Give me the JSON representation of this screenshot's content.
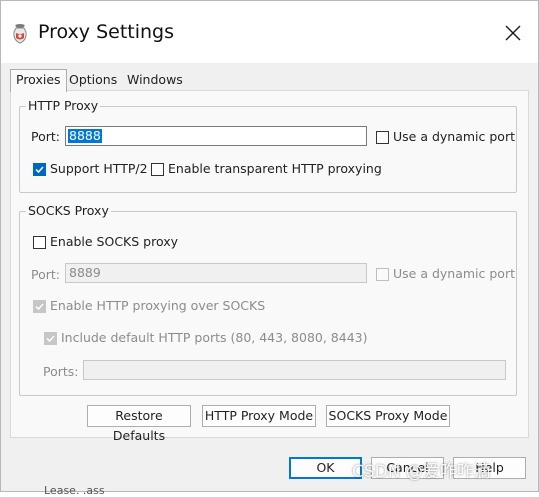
{
  "window": {
    "title": "Proxy Settings"
  },
  "tabs": [
    {
      "label": "Proxies",
      "active": true
    },
    {
      "label": "Options",
      "active": false
    },
    {
      "label": "Windows",
      "active": false
    }
  ],
  "http_proxy": {
    "legend": "HTTP Proxy",
    "port_label": "Port:",
    "port_value": "8888",
    "dynamic_port": {
      "label": "Use a dynamic port",
      "checked": false
    },
    "support_http2": {
      "label": "Support HTTP/2",
      "checked": true
    },
    "transparent": {
      "label": "Enable transparent HTTP proxying",
      "checked": false
    }
  },
  "socks_proxy": {
    "legend": "SOCKS Proxy",
    "enable": {
      "label": "Enable SOCKS proxy",
      "checked": false
    },
    "port_label": "Port:",
    "port_value": "8889",
    "dynamic_port": {
      "label": "Use a dynamic port",
      "checked": false,
      "enabled": false
    },
    "http_over_socks": {
      "label": "Enable HTTP proxying over SOCKS",
      "checked": true,
      "enabled": false
    },
    "include_default_ports": {
      "label": "Include default HTTP ports (80, 443, 8080, 8443)",
      "checked": true,
      "enabled": false
    },
    "ports_label": "Ports:",
    "ports_value": ""
  },
  "mode_buttons": {
    "restore": "Restore Defaults",
    "http_mode": "HTTP Proxy Mode",
    "socks_mode": "SOCKS Proxy Mode"
  },
  "dialog_buttons": {
    "ok": "OK",
    "cancel": "Cancel",
    "help": "Help"
  },
  "overlay": {
    "watermark": "CSDN @爱咋咋滴",
    "underlay_text": "Lease. .ass"
  },
  "colors": {
    "accent": "#0078d7",
    "checkbox_checked": "#0067c0"
  },
  "icons": {
    "app": "charles-jar-icon",
    "close": "close-icon",
    "check": "checkmark-icon"
  }
}
